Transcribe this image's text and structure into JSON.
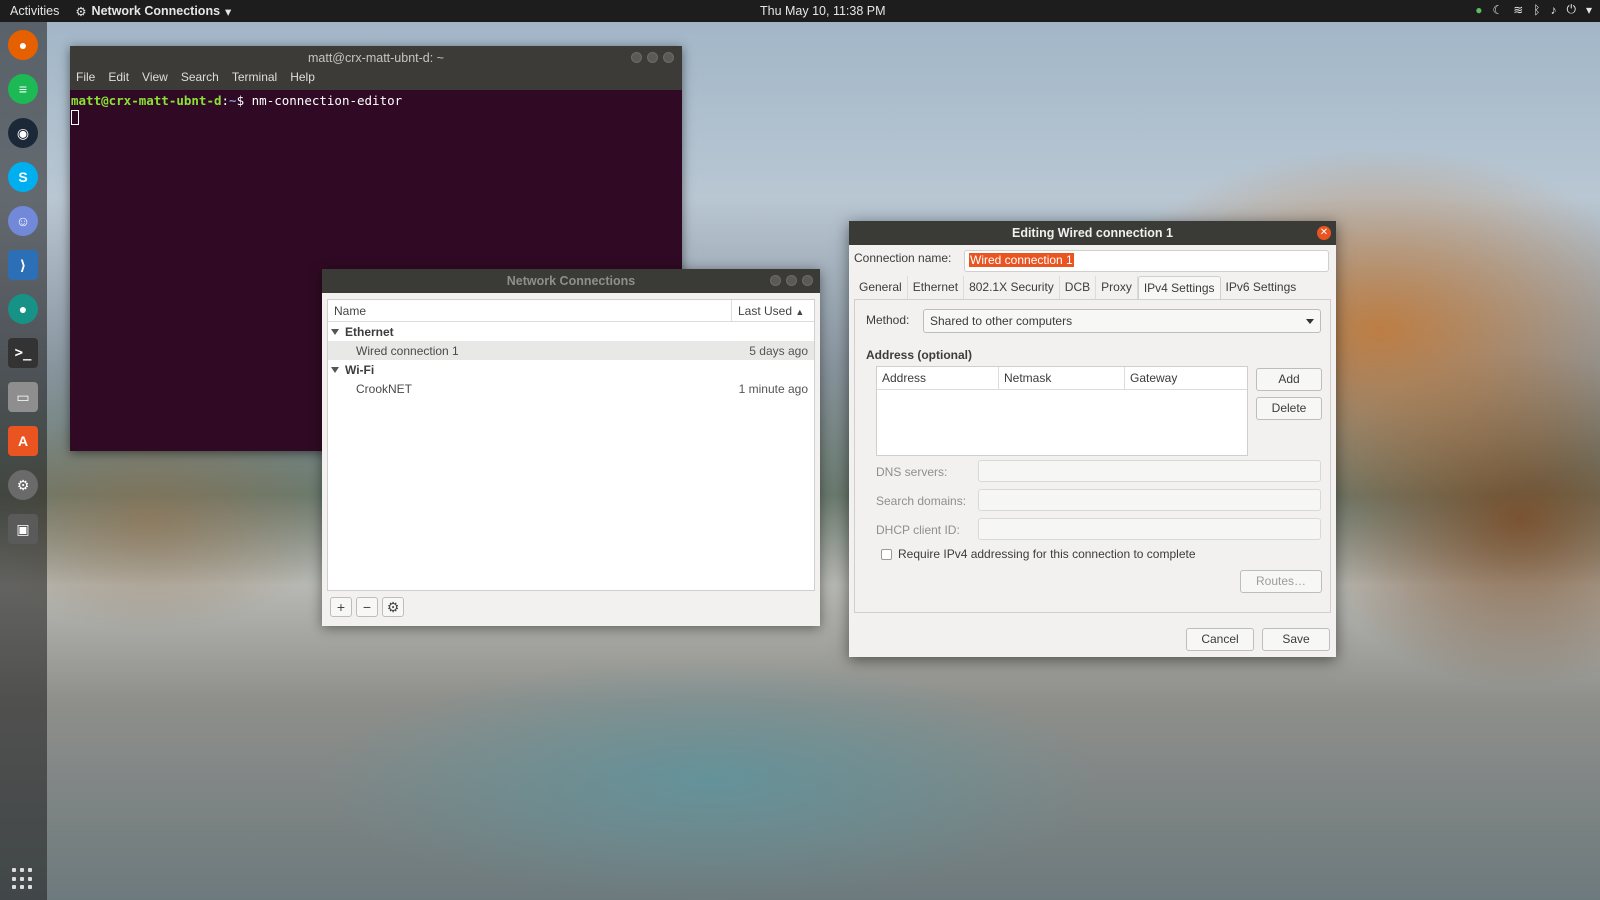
{
  "topbar": {
    "activities": "Activities",
    "app_menu": "Network Connections",
    "clock": "Thu May 10, 11:38 PM"
  },
  "terminal": {
    "title": "matt@crx-matt-ubnt-d: ~",
    "menu": [
      "File",
      "Edit",
      "View",
      "Search",
      "Terminal",
      "Help"
    ],
    "prompt_user": "matt@crx-matt-ubnt-d",
    "prompt_sep": ":",
    "prompt_path": "~",
    "prompt_symbol": "$",
    "command": "nm-connection-editor"
  },
  "network_connections": {
    "title": "Network Connections",
    "col_name": "Name",
    "col_last_used": "Last Used",
    "groups": [
      {
        "name": "Ethernet",
        "items": [
          {
            "name": "Wired connection 1",
            "last_used": "5 days ago"
          }
        ]
      },
      {
        "name": "Wi-Fi",
        "items": [
          {
            "name": "CrookNET",
            "last_used": "1 minute ago"
          }
        ]
      }
    ],
    "toolbar": {
      "add": "+",
      "remove": "−",
      "settings": "⚙"
    }
  },
  "edit_dialog": {
    "title": "Editing Wired connection 1",
    "connection_name_label": "Connection name:",
    "connection_name_value": "Wired connection 1",
    "tabs": [
      "General",
      "Ethernet",
      "802.1X Security",
      "DCB",
      "Proxy",
      "IPv4 Settings",
      "IPv6 Settings"
    ],
    "active_tab": "IPv4 Settings",
    "method_label": "Method:",
    "method_value": "Shared to other computers",
    "address_title": "Address (optional)",
    "address_cols": [
      "Address",
      "Netmask",
      "Gateway"
    ],
    "add_button": "Add",
    "delete_button": "Delete",
    "dns_label": "DNS servers:",
    "search_domains_label": "Search domains:",
    "dhcp_label": "DHCP client ID:",
    "require_ipv4_label": "Require IPv4 addressing for this connection to complete",
    "routes_button": "Routes…",
    "cancel_button": "Cancel",
    "save_button": "Save"
  }
}
